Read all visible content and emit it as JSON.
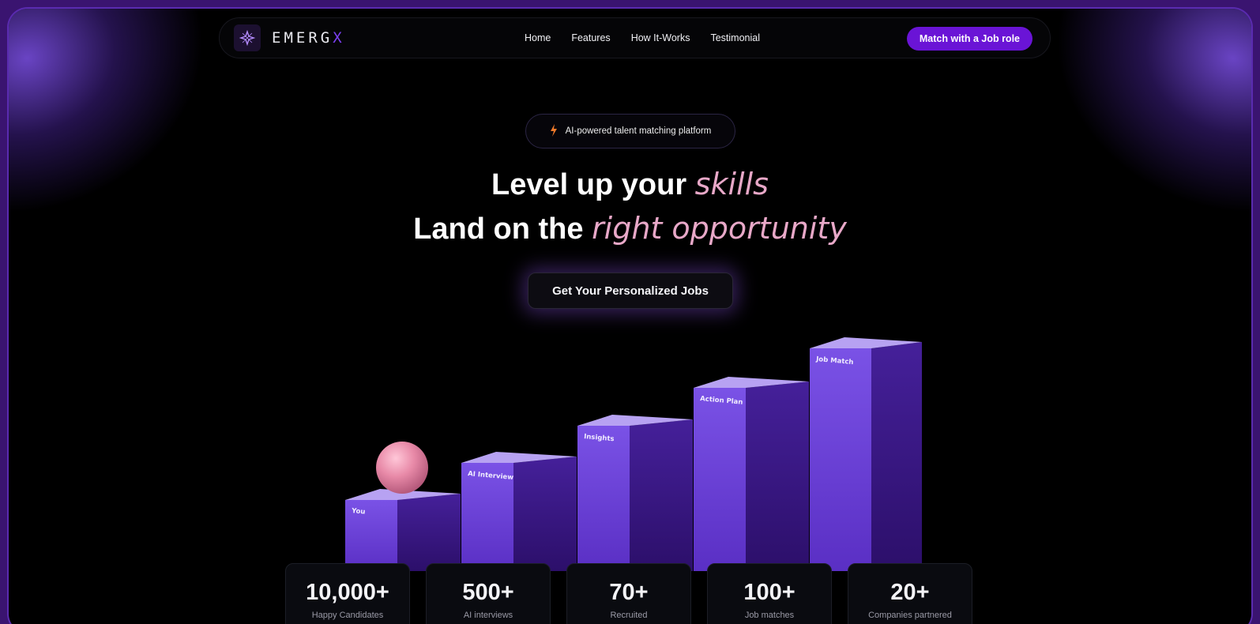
{
  "brand": {
    "name": "EMERG",
    "accent_letter": "X",
    "logo_icon": "sparkle-icon"
  },
  "nav": {
    "links": [
      "Home",
      "Features",
      "How It-Works",
      "Testimonial"
    ],
    "cta_label": "Match with a Job role"
  },
  "hero": {
    "badge_icon": "lightning-icon",
    "badge_text": "AI-powered talent matching platform",
    "line1_plain": "Level up your",
    "line1_emphasis": "skills",
    "line2_plain": "Land on the",
    "line2_emphasis": "right opportunity",
    "button_label": "Get Your Personalized Jobs"
  },
  "steps": [
    "You",
    "AI Interview",
    "Insights",
    "Action Plan",
    "Job Match"
  ],
  "stats": [
    {
      "value": "10,000+",
      "label": "Happy Candidates"
    },
    {
      "value": "500+",
      "label": "AI interviews"
    },
    {
      "value": "70+",
      "label": "Recruited"
    },
    {
      "value": "100+",
      "label": "Job matches"
    },
    {
      "value": "20+",
      "label": "Companies partnered"
    }
  ],
  "colors": {
    "accent": "#6a14d6",
    "emphasis_text": "#e8a8c8",
    "bar_front": "#6b3fd4",
    "bar_side": "#3e1a8a",
    "bar_top": "#b7a2f2",
    "ball": "#e88aa8"
  }
}
